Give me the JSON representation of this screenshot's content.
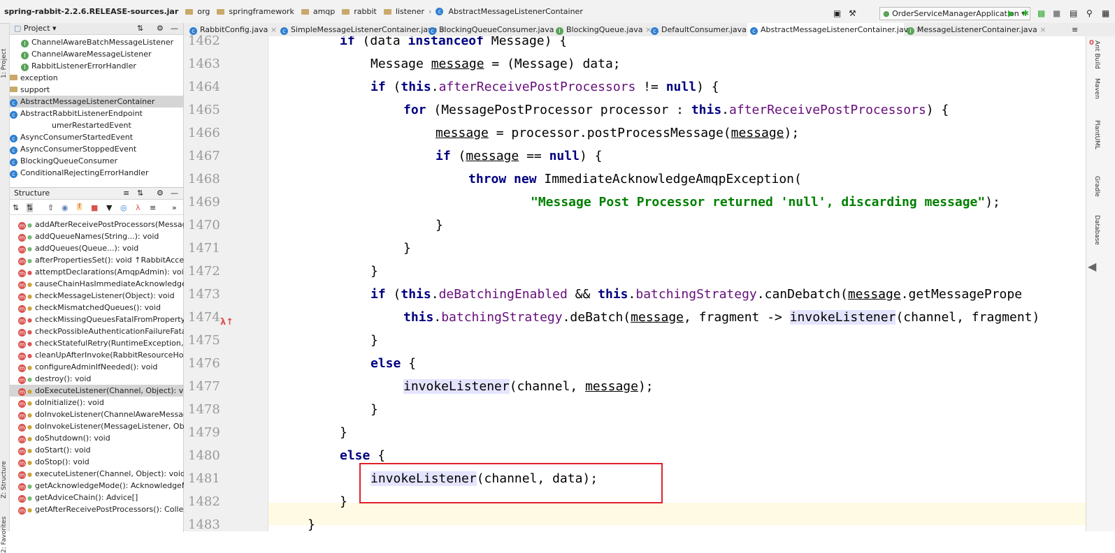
{
  "breadcrumbs": [
    "spring-rabbit-2.2.6.RELEASE-sources.jar",
    "org",
    "springframework",
    "amqp",
    "rabbit",
    "listener",
    "AbstractMessageListenerContainer"
  ],
  "run_config": "OrderServiceManagerApplication",
  "left_strip": {
    "project": "1: Project",
    "structure": "Z: Structure",
    "favorites": "2: Favorites"
  },
  "right_strip": [
    "Ant Build",
    "Maven",
    "PlantUML",
    "Gradle",
    "Database"
  ],
  "project_panel": {
    "title": "Project",
    "items": [
      {
        "label": "ChannelAwareBatchMessageListener",
        "icon": "interface"
      },
      {
        "label": "ChannelAwareMessageListener",
        "icon": "interface"
      },
      {
        "label": "RabbitListenerErrorHandler",
        "icon": "interface"
      },
      {
        "label": "exception",
        "icon": "folder"
      },
      {
        "label": "support",
        "icon": "folder"
      },
      {
        "label": "AbstractMessageListenerContainer",
        "icon": "class"
      },
      {
        "label": "AbstractRabbitListenerEndpoint",
        "icon": "class"
      },
      {
        "label": "umerRestartedEvent",
        "icon": "class"
      },
      {
        "label": "AsyncConsumerStartedEvent",
        "icon": "class"
      },
      {
        "label": "AsyncConsumerStoppedEvent",
        "icon": "class"
      },
      {
        "label": "BlockingQueueConsumer",
        "icon": "class"
      },
      {
        "label": "ConditionalRejectingErrorHandler",
        "icon": "class"
      }
    ]
  },
  "structure_panel": {
    "title": "Structure",
    "items": [
      "addAfterReceivePostProcessors(MessagePo",
      "addQueueNames(String...): void",
      "addQueues(Queue...): void",
      "afterPropertiesSet(): void ↑RabbitAccessor",
      "attemptDeclarations(AmqpAdmin): void",
      "causeChainHasImmediateAcknowledgeAmc",
      "checkMessageListener(Object): void",
      "checkMismatchedQueues(): void",
      "checkMissingQueuesFatalFromProperty(): v",
      "checkPossibleAuthenticationFailureFatalFror",
      "checkStatefulRetry(RuntimeException, Mess",
      "cleanUpAfterInvoke(RabbitResourceHolder,",
      "configureAdminIfNeeded(): void",
      "destroy(): void",
      "doExecuteListener(Channel, Object): void",
      "doInitialize(): void",
      "doInvokeListener(ChannelAwareMessageLis",
      "doInvokeListener(MessageListener, Object)",
      "doShutdown(): void",
      "doStart(): void",
      "doStop(): void",
      "executeListener(Channel, Object): void",
      "getAcknowledgeMode(): AcknowledgeMod",
      "getAdviceChain(): Advice[]",
      "getAfterReceivePostProcessors(): Collection"
    ]
  },
  "tabs": [
    "RabbitConfig.java",
    "SimpleMessageListenerContainer.java",
    "BlockingQueueConsumer.java",
    "BlockingQueue.java",
    "DefaultConsumer.java",
    "AbstractMessageListenerContainer.java",
    "MessageListenerContainer.java"
  ],
  "editor": {
    "line_numbers": [
      "1462",
      "1463",
      "1464",
      "1465",
      "1466",
      "1467",
      "1468",
      "1469",
      "1470",
      "1471",
      "1472",
      "1473",
      "1474",
      "1475",
      "1476",
      "1477",
      "1478",
      "1479",
      "1480",
      "1481",
      "1482",
      "1483"
    ],
    "code": {
      "l1462": [
        "if",
        " (data ",
        "instanceof",
        " Message) {"
      ],
      "l1463": [
        "Message ",
        "message",
        " = (Message) data;"
      ],
      "l1464": [
        "if",
        " (",
        "this",
        ".",
        "afterReceivePostProcessors",
        " != ",
        "null",
        ") {"
      ],
      "l1465": [
        "for",
        " (MessagePostProcessor processor : ",
        "this",
        ".",
        "afterReceivePostProcessors",
        ") {"
      ],
      "l1466": [
        "message",
        " = processor.postProcessMessage(",
        "message",
        ");"
      ],
      "l1467": [
        "if",
        " (",
        "message",
        " == ",
        "null",
        ") {"
      ],
      "l1468": [
        "throw new",
        " ImmediateAcknowledgeAmqpException("
      ],
      "l1469": [
        "\"Message Post Processor returned 'null', discarding message\"",
        ");"
      ],
      "l1470": "}",
      "l1471": "}",
      "l1472": "}",
      "l1473": [
        "if",
        " (",
        "this",
        ".",
        "deBatchingEnabled",
        " && ",
        "this",
        ".",
        "batchingStrategy",
        ".canDebatch(",
        "message",
        ".getMessagePrope"
      ],
      "l1474": [
        "this",
        ".",
        "batchingStrategy",
        ".deBatch(",
        "message",
        ", fragment -> ",
        "invokeListener",
        "(channel, fragment)"
      ],
      "l1475": "}",
      "l1476": [
        "else",
        " {"
      ],
      "l1477": [
        "invokeListener",
        "(channel, ",
        "message",
        ");"
      ],
      "l1478": "}",
      "l1479": "}",
      "l1480": [
        "else",
        " {"
      ],
      "l1481": [
        "invokeListener",
        "(channel, data);"
      ],
      "l1482": "}",
      "l1483": "}"
    }
  },
  "colors": {
    "highlight_box": "#e0202a",
    "keyword": "#000080",
    "field": "#660e7a",
    "string": "#008000"
  }
}
